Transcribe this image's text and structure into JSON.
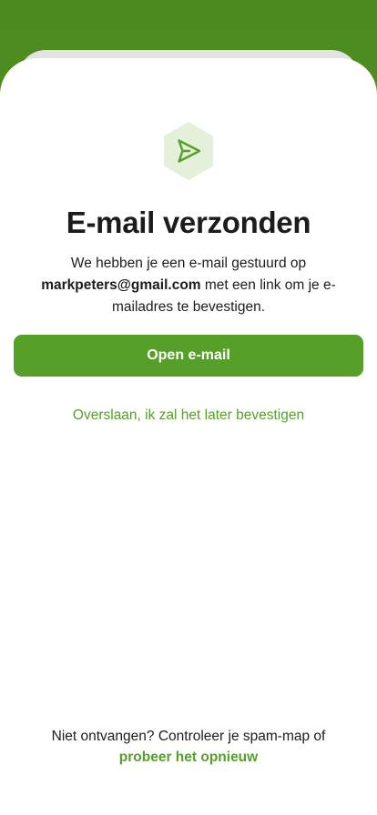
{
  "header": {
    "title": "E-mail verzonden",
    "message_before": "We hebben je een e-mail gestuurd op",
    "email": "markpeters@gmail.com",
    "message_after": "met een link om je e-mailadres te bevestigen."
  },
  "actions": {
    "open_email_label": "Open e-mail",
    "skip_label": "Overslaan, ik zal het later bevestigen"
  },
  "footer": {
    "prompt": "Niet ontvangen? Controleer je spam-map of",
    "retry_label": "probeer het opnieuw"
  },
  "icons": {
    "sent": "send-icon"
  },
  "colors": {
    "brand_green": "#56a02a",
    "header_green": "#4a8a1f",
    "icon_bg": "#e4f0d9",
    "text": "#1c1c1c"
  }
}
